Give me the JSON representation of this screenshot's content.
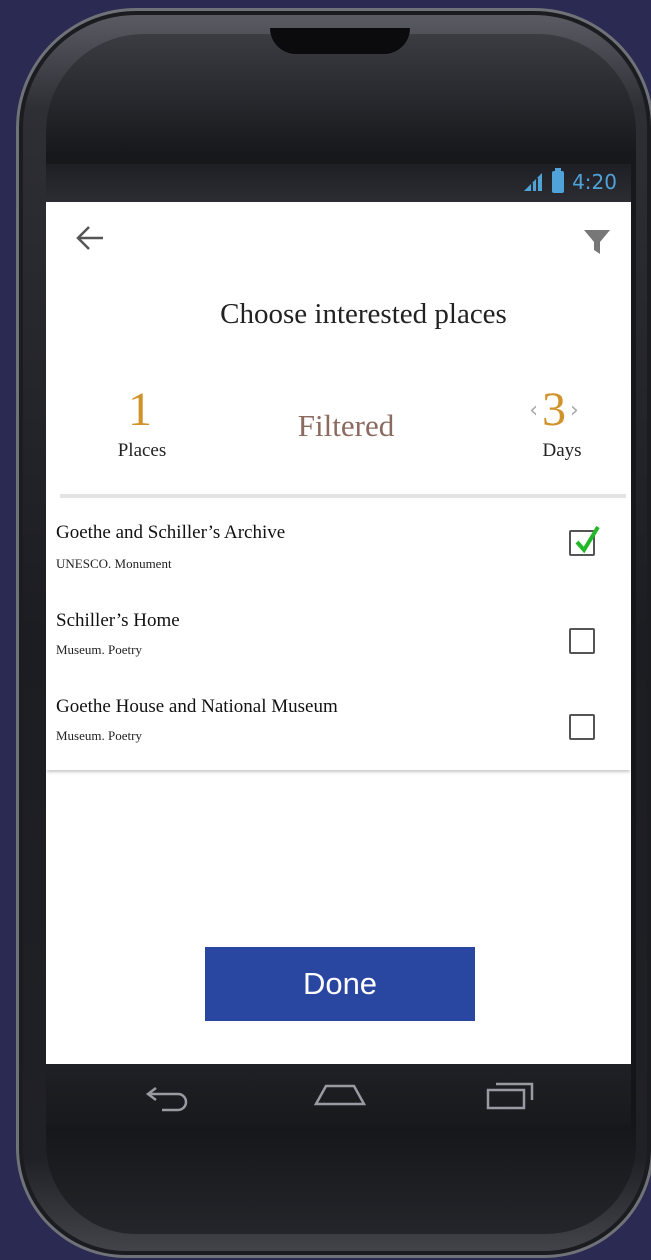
{
  "status_bar": {
    "time": "4:20",
    "icons": [
      "signal-icon",
      "battery-icon"
    ],
    "icon_color": "#4fa3d9"
  },
  "toolbar": {
    "back_icon": "arrow-left-icon",
    "filter_icon": "funnel-icon"
  },
  "page": {
    "title": "Choose interested places"
  },
  "stats": {
    "places_count": "1",
    "places_label": "Places",
    "filtered_label": "Filtered",
    "days_prev": "‹",
    "days_count": "3",
    "days_next": "›",
    "days_label": "Days",
    "accent_color": "#d1922a"
  },
  "places": [
    {
      "title": "Goethe and Schiller’s Archive",
      "subtitle": "UNESCO. Monument",
      "checked": true
    },
    {
      "title": "Schiller’s Home",
      "subtitle": "Museum. Poetry",
      "checked": false
    },
    {
      "title": "Goethe House and National Museum",
      "subtitle": "Museum. Poetry",
      "checked": false
    }
  ],
  "done_button": {
    "label": "Done",
    "color": "#2946a1"
  },
  "nav_bar": {
    "icons": [
      "back-nav-icon",
      "home-nav-icon",
      "recent-apps-icon"
    ]
  }
}
